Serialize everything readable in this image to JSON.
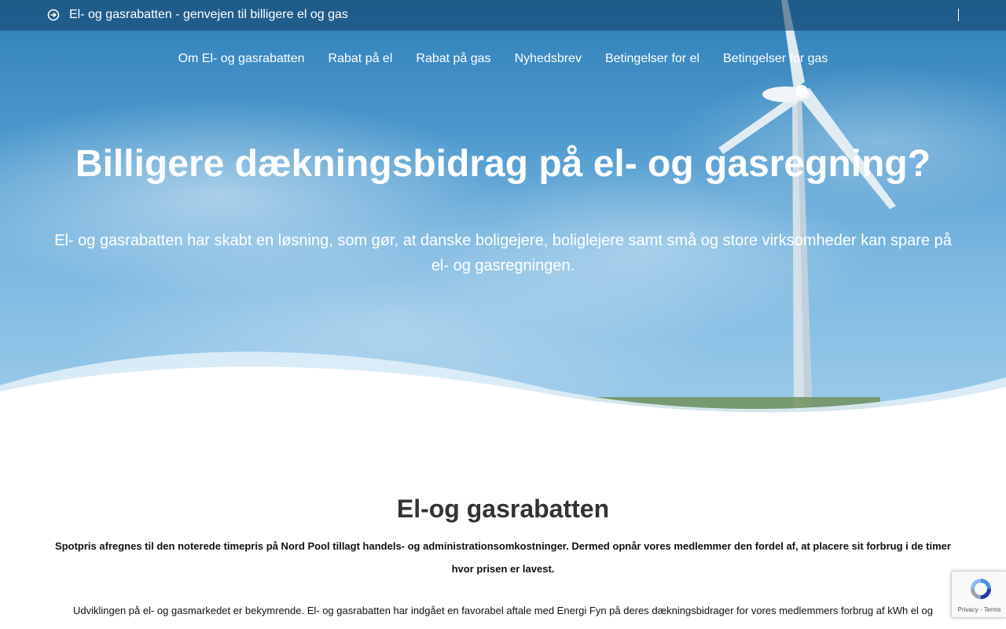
{
  "topbar": {
    "tagline": "El- og gasrabatten - genvejen til billigere el og gas",
    "icon": "arrow-circle-right-icon"
  },
  "nav": {
    "items": [
      "Om El- og gasrabatten",
      "Rabat på el",
      "Rabat på gas",
      "Nyhedsbrev",
      "Betingelser for el",
      "Betingelser for gas"
    ]
  },
  "hero": {
    "title": "Billigere dækningsbidrag på el- og gasregning?",
    "subtitle": "El- og gasrabatten har skabt en løsning, som gør, at danske boligejere, boliglejere samt små og store virksomheder kan spare på el- og gasregningen."
  },
  "main": {
    "title": "El-og gasrabatten",
    "lead": "Spotpris afregnes til den noterede timepris på Nord Pool tillagt handels- og administrationsomkostninger. Dermed opnår vores medlemmer den fordel af, at placere sit forbrug i de timer hvor prisen er lavest.",
    "body": "Udviklingen på el- og gasmarkedet er bekymrende. El- og gasrabatten har indgået en favorabel aftale med Energi Fyn på deres dækningsbidrager for vores medlemmers forbrug af kWh el og"
  },
  "recaptcha": {
    "text": "Privacy - Terms",
    "icon": "recaptcha-icon"
  },
  "colors": {
    "topbar": "#1b4f7a",
    "sky": "#4a97cc",
    "heading": "#333333"
  }
}
